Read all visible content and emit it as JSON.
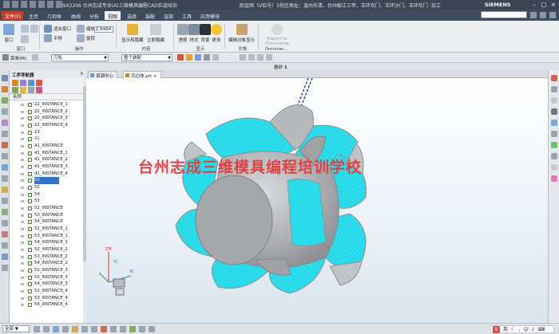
{
  "window": {
    "title": "NX2206 台州志成专业UG三维模具编程CAD实战培训",
    "notice": "脸盆网（V铝号）5校区地址：温州乐清、台州椒江三甲、玉环坎门、玉环沙门、玉环坎门 -加工",
    "brand": "SIEMENS"
  },
  "menu": {
    "file": "文件(F)",
    "tabs": [
      "主页",
      "几何体",
      "曲线",
      "分析",
      "视图",
      "选择",
      "装配",
      "渲染",
      "工具",
      "应用模块"
    ],
    "active_tab": "视图"
  },
  "ribbon": {
    "window_group": {
      "label": "窗口",
      "new_window": "窗口"
    },
    "ops_group": {
      "label": "操作",
      "fit_window": "适合窗口",
      "zoom": "缩放",
      "zoom_value": "1.8484",
      "pan": "平移",
      "rotate": "旋转",
      "fit": "适合"
    },
    "content_group": {
      "label": "内容",
      "show_hide": "显示和隐藏",
      "quick_hide": "立即隐藏"
    },
    "display_group": {
      "label": "显示",
      "wireframe": "透视",
      "style": "样式",
      "background": "背景",
      "more": "更多"
    },
    "object_group": {
      "label": "对象",
      "edit_display": "编辑对象显示"
    },
    "omniverse": {
      "export": "Export to Omniverse",
      "label": "Omniver..."
    }
  },
  "toolbar2": {
    "menu": "菜单(M)",
    "filter_value": "刀轨",
    "assembly_value": "整个装配"
  },
  "graphics_title": "总计 1",
  "navigator": {
    "title": "工序导航器",
    "column": "名称",
    "items": [
      "22_INSTANCE_1",
      "22_INSTANCE_2",
      "22_INSTANCE_3",
      "22_INSTANCE_4",
      "23",
      "41",
      "41_INSTANCE",
      "41_INSTANCE_1",
      "41_INSTANCE_2",
      "41_INSTANCE_3",
      "41_INSTANCE_4",
      "51",
      "52",
      "54",
      "53",
      "52_INSTANCE",
      "53_INSTANCE",
      "54_INSTANCE",
      "52_INSTANCE_1",
      "53_INSTANCE_1",
      "54_INSTANCE_1",
      "52_INSTANCE_2",
      "53_INSTANCE_2",
      "54_INSTANCE_2",
      "52_INSTANCE_3",
      "53_INSTANCE_3",
      "54_INSTANCE_3",
      "52_INSTANCE_4",
      "53_INSTANCE_4",
      "54_INSTANCE_4"
    ],
    "selected_index": 11,
    "blue_index": 5
  },
  "doc_tabs": [
    "资源中心",
    "花边体.prt"
  ],
  "active_doc_tab": "花边体.prt",
  "watermark": "台州志成三维模具编程培训学校",
  "triad": {
    "x": "XC",
    "y": "YC",
    "z": "ZM"
  },
  "status": {
    "selection": "全部",
    "ime": "英"
  },
  "colors": {
    "accent_file": "#c2402d",
    "toolpath": "#2fe0ee",
    "part": "#a9abaf",
    "selection": "#2f74c8",
    "watermark": "#e23a3a"
  }
}
